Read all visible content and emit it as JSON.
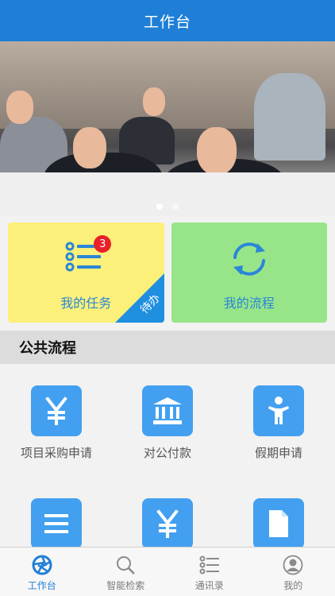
{
  "header": {
    "title": "工作台"
  },
  "banner": {
    "dot_count": 2,
    "active_dot": 0
  },
  "cards": {
    "tasks": {
      "label": "我的任务",
      "badge_count": "3",
      "ribbon": "待办",
      "icon": "task-list-icon"
    },
    "flows": {
      "label": "我的流程",
      "icon": "refresh-cycle-icon"
    }
  },
  "public_process": {
    "title": "公共流程",
    "items": [
      {
        "label": "项目采购申请",
        "icon": "yen-icon"
      },
      {
        "label": "对公付款",
        "icon": "bank-icon"
      },
      {
        "label": "假期申请",
        "icon": "person-icon"
      },
      {
        "label": "",
        "icon": "list-icon"
      },
      {
        "label": "",
        "icon": "yen-icon"
      },
      {
        "label": "",
        "icon": "document-icon"
      }
    ]
  },
  "tabbar": {
    "items": [
      {
        "label": "工作台",
        "icon": "aperture-icon",
        "active": true
      },
      {
        "label": "智能检索",
        "icon": "search-icon",
        "active": false
      },
      {
        "label": "通讯录",
        "icon": "contacts-list-icon",
        "active": false
      },
      {
        "label": "我的",
        "icon": "user-icon",
        "active": false
      }
    ]
  },
  "colors": {
    "primary": "#1f7fd6",
    "tile_blue": "#43a0f0",
    "task_yellow": "#fbf07a",
    "flow_green": "#98e589",
    "badge_red": "#e8202a"
  }
}
